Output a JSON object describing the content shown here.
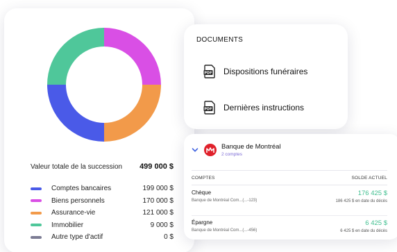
{
  "summary": {
    "total_label": "Valeur totale de la succession",
    "total_value": "499 000 $",
    "legend": [
      {
        "label": "Comptes bancaires",
        "value": "199 000 $",
        "color": "#4a5ae8"
      },
      {
        "label": "Biens personnels",
        "value": "170 000 $",
        "color": "#d94fe5"
      },
      {
        "label": "Assurance-vie",
        "value": "121 000 $",
        "color": "#f29a4a"
      },
      {
        "label": "Immobilier",
        "value": "9 000 $",
        "color": "#4fc79a"
      },
      {
        "label": "Autre type d'actif",
        "value": "0 $",
        "color": "#7c7c94"
      }
    ]
  },
  "chart_data": {
    "type": "pie",
    "categories": [
      "Biens personnels",
      "Assurance-vie",
      "Comptes bancaires",
      "Immobilier"
    ],
    "values": [
      25,
      25,
      25,
      25
    ],
    "colors": [
      "#d94fe5",
      "#f29a4a",
      "#4a5ae8",
      "#4fc79a"
    ],
    "donut": true
  },
  "documents": {
    "title": "DOCUMENTS",
    "items": [
      {
        "label": "Dispositions funéraires",
        "icon": "pdf-icon"
      },
      {
        "label": "Dernières instructions",
        "icon": "pdf-icon"
      }
    ]
  },
  "bank": {
    "name": "Banque de Montréal",
    "subtitle": "2 comptes",
    "col_accounts": "COMPTES",
    "col_balance": "SOLDE ACTUEL",
    "accounts": [
      {
        "name": "Chèque",
        "detail": "Banque de Montréal Com...(...-123)",
        "balance": "176 425 $",
        "note": "186 425 $ en date du décès"
      },
      {
        "name": "Épargne",
        "detail": "Banque de Montréal Com...(...-456)",
        "balance": "6 425 $",
        "note": "6 425 $ en date du décès"
      }
    ]
  }
}
